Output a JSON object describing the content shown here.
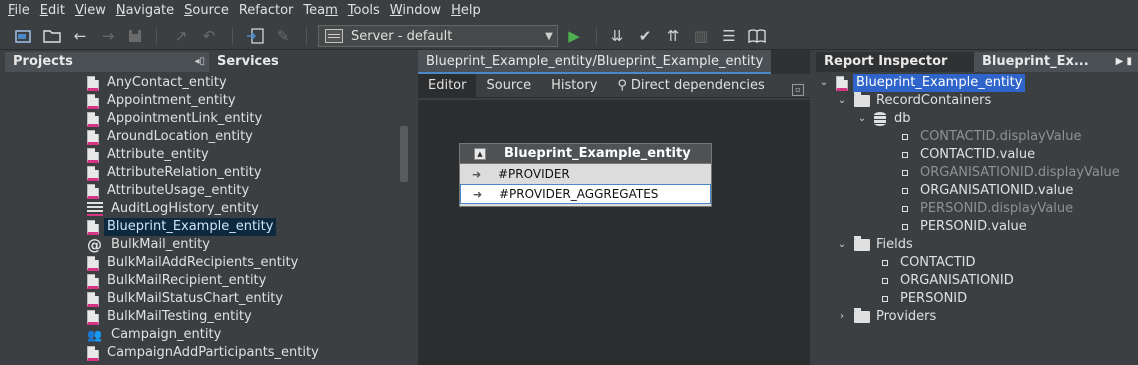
{
  "menubar": {
    "items": [
      {
        "first": "F",
        "rest": "ile"
      },
      {
        "first": "E",
        "rest": "dit"
      },
      {
        "first": "V",
        "rest": "iew"
      },
      {
        "first": "N",
        "rest": "avigate"
      },
      {
        "first": "S",
        "rest": "ource"
      },
      {
        "first": "Ref",
        "rest": "actor"
      },
      {
        "first": "Tea",
        "rest": "m"
      },
      {
        "first": "T",
        "rest": "ools"
      },
      {
        "first": "W",
        "rest": "indow"
      },
      {
        "first": "H",
        "rest": "elp"
      }
    ]
  },
  "toolbar": {
    "server": "Server - default"
  },
  "left": {
    "tab_projects": "Projects",
    "tab_services": "Services",
    "items": [
      {
        "label": "AnyContact_entity",
        "icon": "entity-file-icon"
      },
      {
        "label": "Appointment_entity",
        "icon": "entity-file-icon"
      },
      {
        "label": "AppointmentLink_entity",
        "icon": "entity-file-icon"
      },
      {
        "label": "AroundLocation_entity",
        "icon": "entity-file-icon"
      },
      {
        "label": "Attribute_entity",
        "icon": "entity-file-icon"
      },
      {
        "label": "AttributeRelation_entity",
        "icon": "entity-file-icon"
      },
      {
        "label": "AttributeUsage_entity",
        "icon": "entity-file-icon"
      },
      {
        "label": "AuditLogHistory_entity",
        "icon": "list-icon"
      },
      {
        "label": "Blueprint_Example_entity",
        "icon": "entity-file-icon"
      },
      {
        "label": "BulkMail_entity",
        "icon": "at-icon"
      },
      {
        "label": "BulkMailAddRecipients_entity",
        "icon": "entity-file-icon"
      },
      {
        "label": "BulkMailRecipient_entity",
        "icon": "entity-file-icon"
      },
      {
        "label": "BulkMailStatusChart_entity",
        "icon": "entity-file-icon"
      },
      {
        "label": "BulkMailTesting_entity",
        "icon": "entity-file-icon"
      },
      {
        "label": "Campaign_entity",
        "icon": "people-icon"
      },
      {
        "label": "CampaignAddParticipants_entity",
        "icon": "entity-file-icon"
      }
    ]
  },
  "editor": {
    "tab": "Blueprint_Example_entity/Blueprint_Example_entity",
    "subtabs": [
      "Editor",
      "Source",
      "History",
      "Direct dependencies"
    ],
    "entity": {
      "title": "Blueprint_Example_entity",
      "rows": [
        "#PROVIDER",
        "#PROVIDER_AGGREGATES"
      ]
    }
  },
  "inspector": {
    "tab_report": "Report Inspector",
    "tab_blueprint": "Blueprint_Ex...",
    "root": "Blueprint_Example_entity",
    "record_containers": "RecordContainers",
    "db": "db",
    "db_items": [
      {
        "label": "CONTACTID.displayValue",
        "dim": true
      },
      {
        "label": "CONTACTID.value",
        "dim": false
      },
      {
        "label": "ORGANISATIONID.displayValue",
        "dim": true
      },
      {
        "label": "ORGANISATIONID.value",
        "dim": false
      },
      {
        "label": "PERSONID.displayValue",
        "dim": true
      },
      {
        "label": "PERSONID.value",
        "dim": false
      }
    ],
    "fields": "Fields",
    "field_items": [
      "CONTACTID",
      "ORGANISATIONID",
      "PERSONID"
    ],
    "providers": "Providers"
  }
}
